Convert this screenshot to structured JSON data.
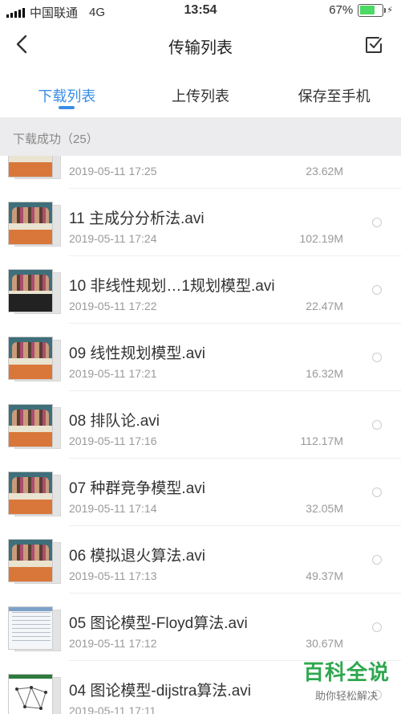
{
  "status_bar": {
    "carrier": "中国联通",
    "network": "4G",
    "time": "13:54",
    "battery": "67%",
    "battery_level": 0.67
  },
  "nav": {
    "title": "传输列表",
    "back_icon": "chevron-left-icon",
    "right_icon": "checkbox-select-icon"
  },
  "tabs": [
    {
      "label": "下载列表",
      "active": true
    },
    {
      "label": "上传列表",
      "active": false
    },
    {
      "label": "保存至手机",
      "active": false
    }
  ],
  "section_header": "下载成功（25）",
  "files": [
    {
      "name": "",
      "date": "2019-05-11 17:25",
      "size": "23.62M",
      "thumb": "video"
    },
    {
      "name": "11 主成分分析法.avi",
      "date": "2019-05-11 17:24",
      "size": "102.19M",
      "thumb": "video"
    },
    {
      "name": "10 非线性规划…1规划模型.avi",
      "date": "2019-05-11 17:22",
      "size": "22.47M",
      "thumb": "video-dark"
    },
    {
      "name": "09 线性规划模型.avi",
      "date": "2019-05-11 17:21",
      "size": "16.32M",
      "thumb": "video"
    },
    {
      "name": "08 排队论.avi",
      "date": "2019-05-11 17:16",
      "size": "112.17M",
      "thumb": "video"
    },
    {
      "name": "07 种群竞争模型.avi",
      "date": "2019-05-11 17:14",
      "size": "32.05M",
      "thumb": "video"
    },
    {
      "name": "06 模拟退火算法.avi",
      "date": "2019-05-11 17:13",
      "size": "49.37M",
      "thumb": "video"
    },
    {
      "name": "05 图论模型-Floyd算法.avi",
      "date": "2019-05-11 17:12",
      "size": "30.67M",
      "thumb": "doc"
    },
    {
      "name": "04 图论模型-dijstra算法.avi",
      "date": "2019-05-11 17:11",
      "size": "",
      "thumb": "graph"
    }
  ],
  "watermark": {
    "title": "百科全说",
    "subtitle": "助你轻松解决"
  },
  "colors": {
    "accent": "#3a8ee6",
    "watermark": "#2fa84f",
    "battery": "#4cd964"
  }
}
